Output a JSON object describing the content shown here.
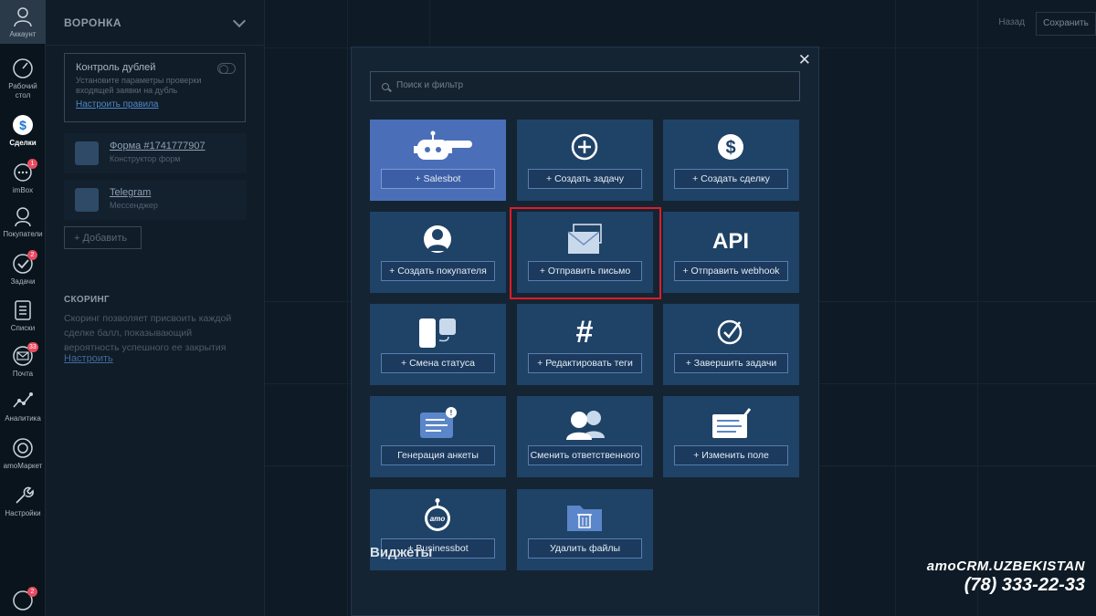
{
  "nav": {
    "account": "Аккаунт",
    "items": [
      {
        "label": "Рабочий стол",
        "icon": "dashboard-icon"
      },
      {
        "label": "Сделки",
        "icon": "deals-icon",
        "active": true
      },
      {
        "label": "imBox",
        "icon": "chat-icon",
        "badge": "1"
      },
      {
        "label": "Покупатели",
        "icon": "customers-icon"
      },
      {
        "label": "Задачи",
        "icon": "tasks-icon",
        "badge": "2"
      },
      {
        "label": "Списки",
        "icon": "lists-icon"
      },
      {
        "label": "Почта",
        "icon": "mail-icon",
        "badge": "33"
      },
      {
        "label": "Аналитика",
        "icon": "analytics-icon"
      },
      {
        "label": "amoМаркет",
        "icon": "market-icon"
      },
      {
        "label": "Настройки",
        "icon": "settings-icon"
      }
    ],
    "bottom_badge": "2"
  },
  "panel": {
    "title": "ВОРОНКА",
    "duplicates": {
      "title": "Контроль дублей",
      "desc": "Установите параметры проверки входящей заявки на дубль",
      "link": "Настроить правила"
    },
    "sources": [
      {
        "title": "Форма #1741777907",
        "subtitle": "Конструктор форм"
      },
      {
        "title": "Telegram",
        "subtitle": "Мессенджер"
      }
    ],
    "add_label": "Добавить",
    "scoring": {
      "title": "СКОРИНГ",
      "desc": "Скоринг позволяет присвоить каждой сделке балл, показывающий вероятность успешного ее закрытия",
      "link": "Настроить"
    }
  },
  "top": {
    "back": "Назад",
    "save": "Сохранить"
  },
  "modal": {
    "search_placeholder": "Поиск и фильтр",
    "tiles": [
      {
        "label": "Salesbot",
        "icon": "robot-icon",
        "plus": true
      },
      {
        "label": "Создать задачу",
        "icon": "plus-circle-icon",
        "plus": true
      },
      {
        "label": "Создать сделку",
        "icon": "dollar-icon",
        "plus": true
      },
      {
        "label": "Создать покупателя",
        "icon": "customer-icon",
        "plus": true
      },
      {
        "label": "Отправить письмо",
        "icon": "envelope-icon",
        "plus": true
      },
      {
        "label": "Отправить webhook",
        "icon": "api-icon",
        "icon_text": "API",
        "plus": true
      },
      {
        "label": "Смена статуса",
        "icon": "status-change-icon",
        "plus": true
      },
      {
        "label": "Редактировать теги",
        "icon": "hashtag-icon",
        "plus": true
      },
      {
        "label": "Завершить задачи",
        "icon": "check-circle-icon",
        "plus": true
      },
      {
        "label": "Генерация анкеты",
        "icon": "form-icon",
        "plus": false
      },
      {
        "label": "Сменить ответственного",
        "icon": "users-icon",
        "plus": false
      },
      {
        "label": "Изменить поле",
        "icon": "edit-field-icon",
        "plus": true
      },
      {
        "label": "Businessbot",
        "icon": "businessbot-icon",
        "icon_text": "amo",
        "plus": true
      },
      {
        "label": "Удалить файлы",
        "icon": "delete-files-icon",
        "plus": false
      }
    ],
    "widgets_title": "Виджеты"
  },
  "watermark": {
    "brand": "amoCRM.UZBEKISTAN",
    "phone": "(78) 333-22-33"
  }
}
